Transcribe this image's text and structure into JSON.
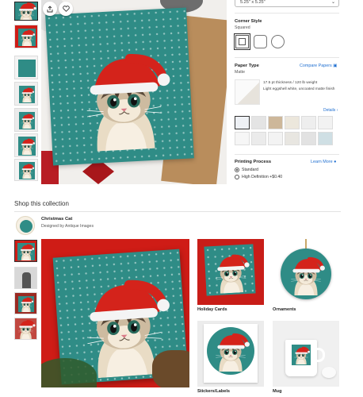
{
  "product": {
    "size_value": "5.25\" x 5.25\"",
    "corner_style": {
      "title": "Corner Style",
      "selected": "Squared",
      "options": [
        "Squared",
        "Rounded",
        "Circle"
      ]
    },
    "paper_type": {
      "title": "Paper Type",
      "selected": "Matte",
      "compare_link": "Compare Papers",
      "desc_line1": "17.5 pt thickness / 120 lb weight",
      "desc_line2": "Light eggshell white, uncoated matte finish",
      "details_link": "Details",
      "swatch_colors": [
        "#eef1f5",
        "#e4e4e4",
        "#cdb79a",
        "#ece7dc",
        "#eeeeee",
        "#f2f2f2",
        "#f6f6f6",
        "#ebebeb",
        "#f3f3f3",
        "#e8e6e1",
        "#e2e2e2",
        "#cfdfe4"
      ]
    },
    "printing_process": {
      "title": "Printing Process",
      "learn_more": "Learn More",
      "options": [
        {
          "label": "Standard",
          "selected": true
        },
        {
          "label": "High Definition  +$0.40",
          "selected": false
        }
      ]
    }
  },
  "collection": {
    "heading": "Shop this collection",
    "name": "Christmas Cat",
    "designer": "Designed by Antique Images",
    "products": [
      "Holiday Cards",
      "Ornaments",
      "Stickers/Labels",
      "Mug"
    ]
  },
  "colors": {
    "teal": "#2f8c86",
    "red": "#cf1c16",
    "link": "#1f6fd1",
    "kraft": "#b98d5c"
  }
}
